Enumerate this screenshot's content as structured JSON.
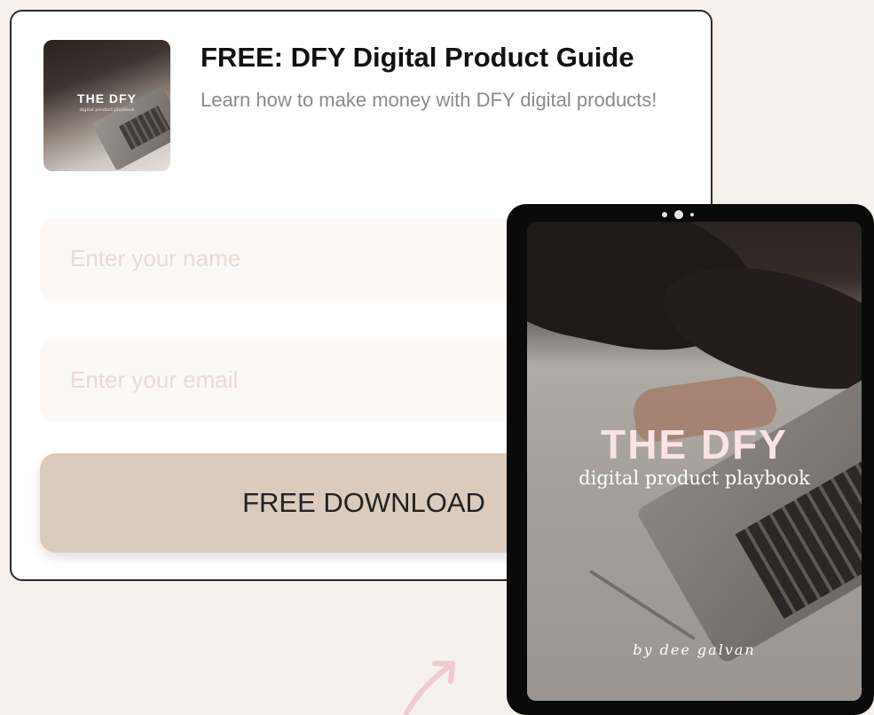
{
  "form": {
    "thumbnail": {
      "title": "THE DFY",
      "subtitle": "digital product playbook"
    },
    "title": "FREE: DFY Digital Product Guide",
    "subtitle": "Learn how to make money with DFY digital products!",
    "name_placeholder": "Enter your name",
    "email_placeholder": "Enter your email",
    "button_label": "FREE DOWNLOAD"
  },
  "tablet": {
    "cover_title": "THE DFY",
    "cover_subtitle": "digital product playbook",
    "cover_author": "by dee galvan"
  },
  "colors": {
    "background": "#f5f1ec",
    "button": "#dbcbbd",
    "placeholder_text": "#eadad3",
    "arrow": "#f2c9cc"
  },
  "icons": [
    "arrow-up-right-icon"
  ]
}
